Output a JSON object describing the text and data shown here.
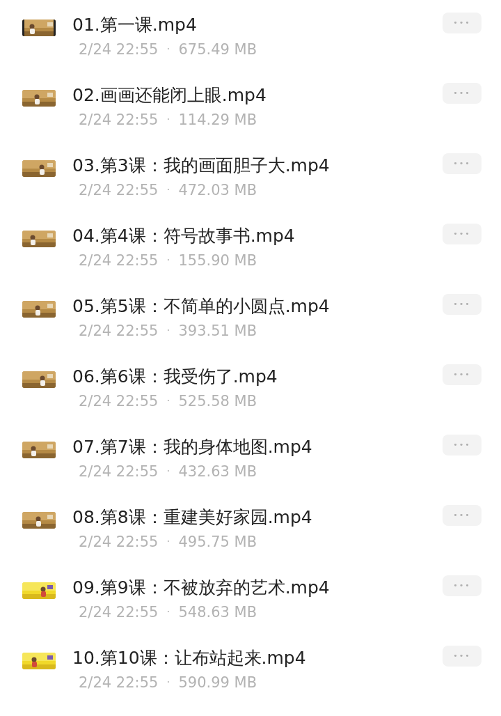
{
  "files": [
    {
      "name": "01.第一课.mp4",
      "date": "2/24 22:55",
      "separator": "·",
      "size": "675.49 MB",
      "more": "•••"
    },
    {
      "name": "02.画画还能闭上眼.mp4",
      "date": "2/24 22:55",
      "separator": "·",
      "size": "114.29 MB",
      "more": "•••"
    },
    {
      "name": "03.第3课：我的画面胆子大.mp4",
      "date": "2/24 22:55",
      "separator": "·",
      "size": "472.03 MB",
      "more": "•••"
    },
    {
      "name": "04.第4课：符号故事书.mp4",
      "date": "2/24 22:55",
      "separator": "·",
      "size": "155.90 MB",
      "more": "•••"
    },
    {
      "name": "05.第5课：不简单的小圆点.mp4",
      "date": "2/24 22:55",
      "separator": "·",
      "size": "393.51 MB",
      "more": "•••"
    },
    {
      "name": "06.第6课：我受伤了.mp4",
      "date": "2/24 22:55",
      "separator": "·",
      "size": "525.58 MB",
      "more": "•••"
    },
    {
      "name": "07.第7课：我的身体地图.mp4",
      "date": "2/24 22:55",
      "separator": "·",
      "size": "432.63 MB",
      "more": "•••"
    },
    {
      "name": "08.第8课：重建美好家园.mp4",
      "date": "2/24 22:55",
      "separator": "·",
      "size": "495.75 MB",
      "more": "•••"
    },
    {
      "name": "09.第9课：不被放弃的艺术.mp4",
      "date": "2/24 22:55",
      "separator": "·",
      "size": "548.63 MB",
      "more": "•••"
    },
    {
      "name": "10.第10课：让布站起来.mp4",
      "date": "2/24 22:55",
      "separator": "·",
      "size": "590.99 MB",
      "more": "•••"
    }
  ]
}
